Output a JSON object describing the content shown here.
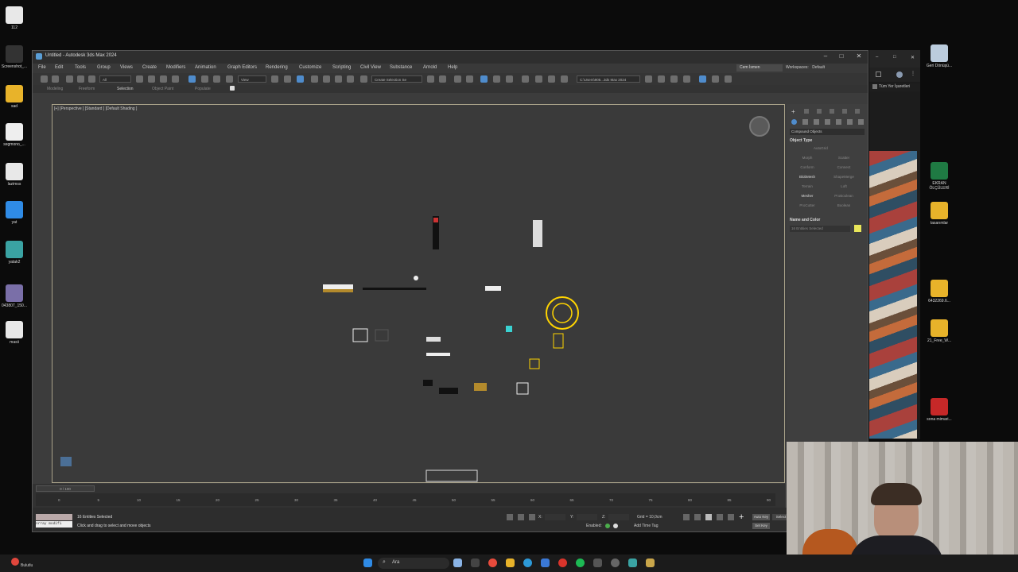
{
  "desktop": {
    "left_icons": [
      {
        "label": "112",
        "name": "desktop-icon-112"
      },
      {
        "label": "Screenshot_...",
        "name": "desktop-icon-screenshot"
      },
      {
        "label": "sad",
        "name": "desktop-icon-sad"
      },
      {
        "label": "segmono_...",
        "name": "desktop-icon-segmono"
      },
      {
        "label": "lazimss",
        "name": "desktop-icon-lazimss"
      },
      {
        "label": "yat",
        "name": "desktop-icon-yat"
      },
      {
        "label": "yatak2",
        "name": "desktop-icon-yatak2"
      },
      {
        "label": "043807_150...",
        "name": "desktop-icon-043807"
      },
      {
        "label": "masii",
        "name": "desktop-icon-masii"
      }
    ],
    "right_icons": [
      {
        "label": "Geri Dönüşü...",
        "name": "desktop-icon-recycle-bin"
      },
      {
        "label": "EKRAN ÖLÇÜLERİ",
        "name": "desktop-icon-excel"
      },
      {
        "label": "tasarımlar",
        "name": "desktop-icon-tasarimlar"
      },
      {
        "label": "6432269.6...",
        "name": "desktop-icon-6432269"
      },
      {
        "label": "21_Free_W...",
        "name": "desktop-icon-21free"
      },
      {
        "label": "sona mimari...",
        "name": "desktop-icon-pdf"
      }
    ]
  },
  "app": {
    "title": "Untitled - Autodesk 3ds Max 2024",
    "menus": [
      "File",
      "Edit",
      "Tools",
      "Group",
      "Views",
      "Create",
      "Modifiers",
      "Animation",
      "Graph Editors",
      "Rendering",
      "Customize",
      "Scripting",
      "Civil View",
      "Substance",
      "Arnold",
      "Help"
    ],
    "sign_in": "Cem İsmen",
    "workspaces_label": "Workspaces:",
    "workspace_value": "Default",
    "toolbar_view_select": "View",
    "toolbar_selection_set": "Create Selection Se",
    "toolbar_path": "C:\\Users\\905...3ds Max 2024",
    "ribbon_tabs": [
      "Modeling",
      "Freeform",
      "Selection",
      "Object Paint",
      "Populate"
    ],
    "ribbon_active": "Selection",
    "viewport_label": "[+] [Perspective ] [Standard ] [Default Shading ]",
    "command_panel": {
      "rollout_title": "Compound Objects",
      "object_type_header": "Object Type",
      "autogrid": "AutoGrid",
      "buttons": [
        "Morph",
        "Scatter",
        "Conform",
        "Connect",
        "BlobMesh",
        "ShapeMerge",
        "Terrain",
        "Loft",
        "Mesher",
        "ProBoolean",
        "ProCutter",
        "Boolean"
      ],
      "name_color_header": "Name and Color",
      "name_field": "16 Entities Selected",
      "color_swatch": "#e9e65a"
    },
    "timeline": {
      "frame_counter": "0 / 100",
      "ticks": [
        "0",
        "5",
        "10",
        "15",
        "20",
        "25",
        "30",
        "35",
        "40",
        "45",
        "50",
        "55",
        "60",
        "65",
        "70",
        "75",
        "80",
        "85",
        "90"
      ]
    },
    "status": {
      "selection": "16 Entities Selected",
      "prompt": "Click and drag to select and move objects",
      "maxscript": "Array modifi",
      "x_label": "X:",
      "y_label": "Y:",
      "z_label": "Z:",
      "grid": "Grid = 10,0cm",
      "enabled": "Enabled:",
      "add_time_tag": "Add Time Tag",
      "auto_key": "Auto Key",
      "set_key": "Set Key",
      "selected": "Select"
    }
  },
  "browser": {
    "bookmark": "Tüm Yer İşaretleri"
  },
  "taskbar": {
    "search_placeholder": "Ara",
    "weather": "Bulutlu"
  }
}
